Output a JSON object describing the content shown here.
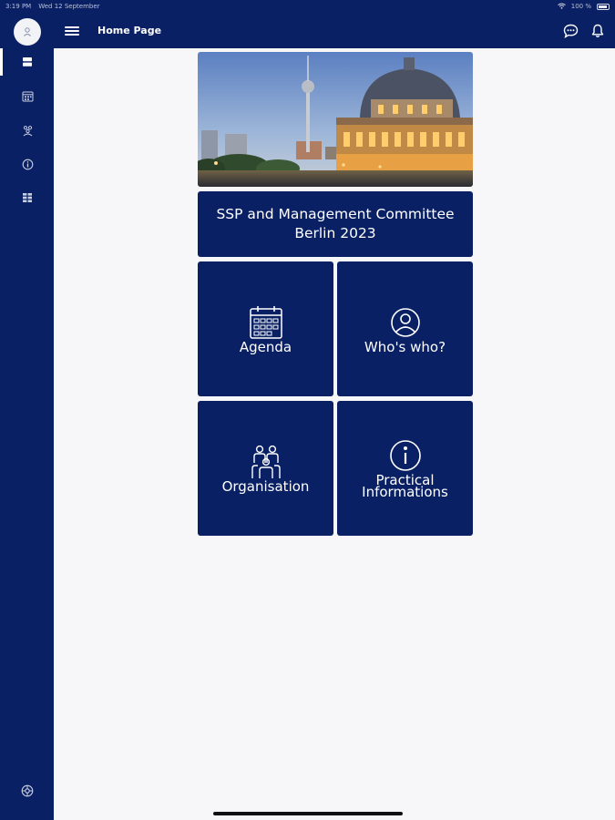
{
  "status_bar": {
    "time": "3:19 PM",
    "date": "Wed 12 September",
    "battery": "100 %"
  },
  "header": {
    "title": "Home Page"
  },
  "sidebar": {
    "items": [
      {
        "icon": "home-icon"
      },
      {
        "icon": "calendar-icon"
      },
      {
        "icon": "organisation-icon"
      },
      {
        "icon": "info-icon"
      },
      {
        "icon": "grid-icon"
      }
    ],
    "footer_icon": "settings-icon"
  },
  "event": {
    "title_line1": "SSP and Management Committee",
    "title_line2": "Berlin 2023"
  },
  "tiles": [
    {
      "label": "Agenda",
      "icon": "calendar-icon"
    },
    {
      "label": "Who's who?",
      "icon": "person-icon"
    },
    {
      "label": "Organisation",
      "icon": "group-icon"
    },
    {
      "label_line1": "Practical",
      "label_line2": "Informations",
      "icon": "info-icon"
    }
  ],
  "colors": {
    "primary": "#0a2064",
    "background": "#f7f6f8"
  }
}
